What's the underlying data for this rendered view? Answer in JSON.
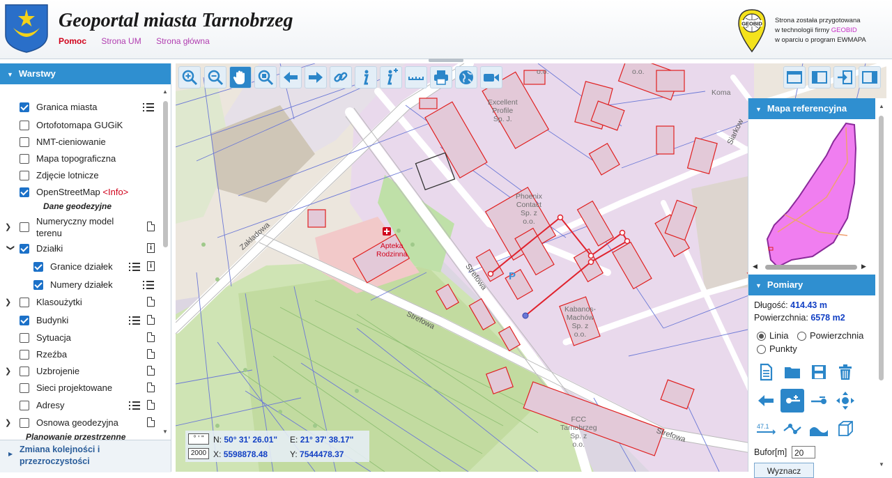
{
  "header": {
    "title": "Geoportal miasta Tarnobrzeg",
    "links": [
      "Pomoc",
      "Strona UM",
      "Strona główna"
    ],
    "logo_text": "GEOBID",
    "credits": {
      "line1": "Strona została przygotowana",
      "line2_prefix": "w technologii firmy ",
      "line2_brand": "GEOBID",
      "line3": "w oparciu o program EWMAPA"
    }
  },
  "layers_panel": {
    "title": "Warstwy",
    "items": [
      {
        "label": "Granica miasta",
        "checked": true
      },
      {
        "label": "Ortofotomapa GUGiK",
        "checked": false
      },
      {
        "label": "NMT-cieniowanie",
        "checked": false
      },
      {
        "label": "Mapa topograficzna",
        "checked": false
      },
      {
        "label": "Zdjęcie lotnicze",
        "checked": false
      },
      {
        "label": "OpenStreetMap",
        "checked": true,
        "info": "<Info>"
      },
      {
        "label": "Numeryczny model terenu",
        "checked": false
      },
      {
        "label": "Działki",
        "checked": true
      },
      {
        "label": "Granice działek",
        "checked": true
      },
      {
        "label": "Numery działek",
        "checked": true
      },
      {
        "label": "Klasoużytki",
        "checked": false
      },
      {
        "label": "Budynki",
        "checked": true
      },
      {
        "label": "Sytuacja",
        "checked": false
      },
      {
        "label": "Rzeźba",
        "checked": false
      },
      {
        "label": "Uzbrojenie",
        "checked": false
      },
      {
        "label": "Sieci projektowane",
        "checked": false
      },
      {
        "label": "Adresy",
        "checked": false
      },
      {
        "label": "Osnowa geodezyjna",
        "checked": false
      }
    ],
    "section_geo": "Dane geodezyjne",
    "section_plan": "Planowanie przestrzenne",
    "footer": "Zmiana kolejności i przezroczystości"
  },
  "map": {
    "labels": {
      "excellent": [
        "Excellent",
        "Profile",
        "Sp. J."
      ],
      "phoenix": [
        "Phoenix",
        "Contact",
        "Sp. z",
        "o.o."
      ],
      "apteka": [
        "Apteka",
        "Rodzinna"
      ],
      "kabanos": [
        "Kabanos-",
        "Machów",
        "Sp. z",
        "o.o."
      ],
      "fcc": [
        "FCC",
        "Tarnobrzeg",
        "Sp. z",
        "o.o."
      ],
      "koma": "Koma",
      "oo_top1": "o.o.",
      "oo_top2": "o.o."
    },
    "streets": {
      "zakladowa": "Zakładowa",
      "strefowa1": "Strefowa",
      "strefowa2": "Strefowa",
      "strefowa3": "Strefowa",
      "siarkowa": "Siarkow"
    },
    "parking": "P",
    "coords": {
      "format_btn": "° ' \"",
      "scale_btn": "2000",
      "n_label": "N:",
      "n_value": "50° 31' 26.01\"",
      "e_label": "E:",
      "e_value": "21° 37' 38.17\"",
      "x_label": "X:",
      "x_value": "5598878.48",
      "y_label": "Y:",
      "y_value": "7544478.37"
    }
  },
  "right_panel": {
    "ref_title": "Mapa referencyjna",
    "meas_title": "Pomiary",
    "length_label": "Długość:",
    "length_value": "414.43 m",
    "area_label": "Powierzchnia:",
    "area_value": "6578 m2",
    "modes": [
      "Linia",
      "Powierzchnia",
      "Punkty"
    ],
    "selected_mode": "Linia",
    "tool_47": "47.1",
    "buffer_label": "Bufor[m]",
    "buffer_value": "20",
    "compute_button": "Wyznacz"
  },
  "colors": {
    "accent": "#2f8fd0",
    "measure_line": "#e0222d",
    "value_blue": "#1240c4",
    "parcel_fill": "#eadcf0",
    "building_stroke": "#e02020"
  }
}
